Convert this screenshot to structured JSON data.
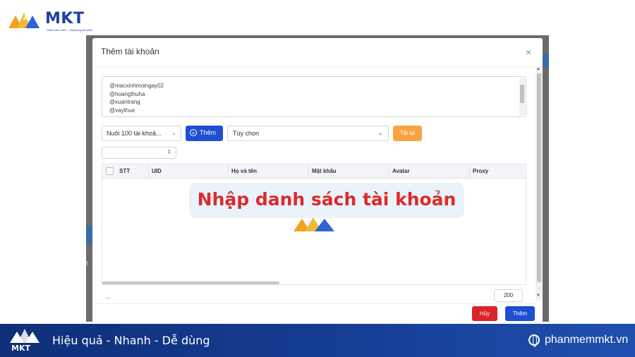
{
  "branding": {
    "brand_name": "MKT",
    "tagline": "Phần mềm MKT - Marketing đa kênh",
    "slogan": "Hiệu quả - Nhanh  - Dễ dùng",
    "website": "phanmemmkt.vn"
  },
  "modal": {
    "title": "Thêm tài khoản",
    "close_glyph": "×",
    "textarea_lines": [
      "@macxinhmoingay02",
      "@hoangthuha",
      "@xuantrang",
      "@vaythue"
    ],
    "account_select": "Nuôi 100 tài khoả...",
    "add_label": "Thêm",
    "option_select": "Tùy chọn",
    "reload_label": "Tải lại",
    "stepper_value": "",
    "table_headers": [
      "STT",
      "UID",
      "Họ và tên",
      "Mật khẩu",
      "Avatar",
      "Proxy"
    ],
    "footer_text": "...",
    "page_size": "200",
    "cancel_label": "Hủy",
    "submit_label": "Thêm"
  },
  "overlay": {
    "banner_text": "Nhập danh sách tài khoản"
  },
  "colors": {
    "primary": "#1e4fd0",
    "danger": "#d9252a",
    "warning": "#f7a440",
    "banner_text": "#dc2b2b",
    "banner_bg": "#eaf3f9"
  }
}
